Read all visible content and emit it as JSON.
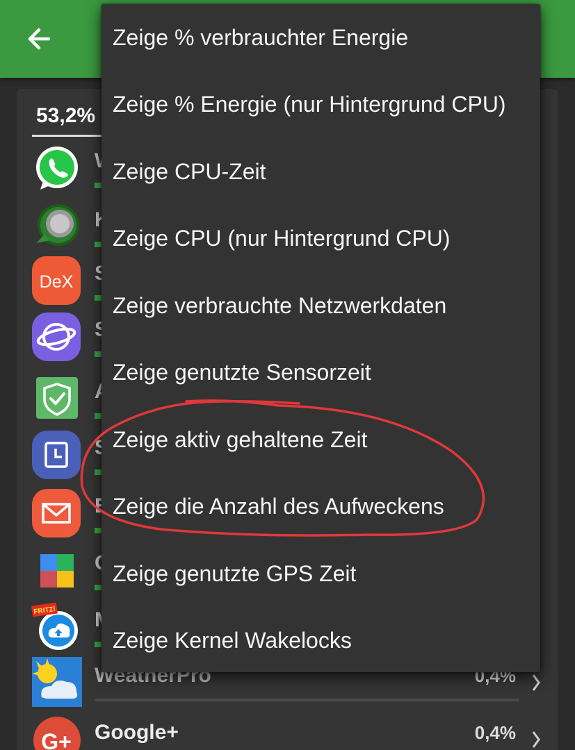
{
  "header": {
    "total_percent": "53,2%"
  },
  "apps": [
    {
      "initial": "W",
      "icon": "whatsapp-icon"
    },
    {
      "initial": "K",
      "icon": "kernel-app-icon"
    },
    {
      "initial": "S",
      "icon": "samsung-dex-icon",
      "icon_text": "DeX"
    },
    {
      "initial": "S",
      "icon": "samsung-internet-icon"
    },
    {
      "initial": "A",
      "icon": "shield-check-icon"
    },
    {
      "initial": "S",
      "icon": "clock-app-icon"
    },
    {
      "initial": "E",
      "icon": "email-icon"
    },
    {
      "initial": "G",
      "icon": "play-services-icon"
    },
    {
      "initial": "M",
      "icon": "myfritz-icon",
      "icon_text": "FRITZ!"
    },
    {
      "name": "WeatherPro",
      "percent": "0,4%",
      "icon": "weatherpro-icon"
    },
    {
      "name": "Google+",
      "percent": "0,4%",
      "icon": "google-plus-icon",
      "icon_text": "G+"
    }
  ],
  "menu": {
    "items": [
      "Zeige % verbrauchter Energie",
      "Zeige % Energie (nur Hintergrund CPU)",
      "Zeige CPU-Zeit",
      "Zeige CPU (nur Hintergrund CPU)",
      "Zeige verbrauchte Netzwerkdaten",
      "Zeige genutzte Sensorzeit",
      "Zeige aktiv gehaltene Zeit",
      "Zeige die Anzahl des Aufweckens",
      "Zeige genutzte GPS Zeit",
      "Zeige Kernel Wakelocks"
    ]
  },
  "colors": {
    "appbar": "#3b9a3f",
    "menu_bg": "#333333",
    "annotation": "#e0383a",
    "usage_bar": "#3aa745"
  }
}
